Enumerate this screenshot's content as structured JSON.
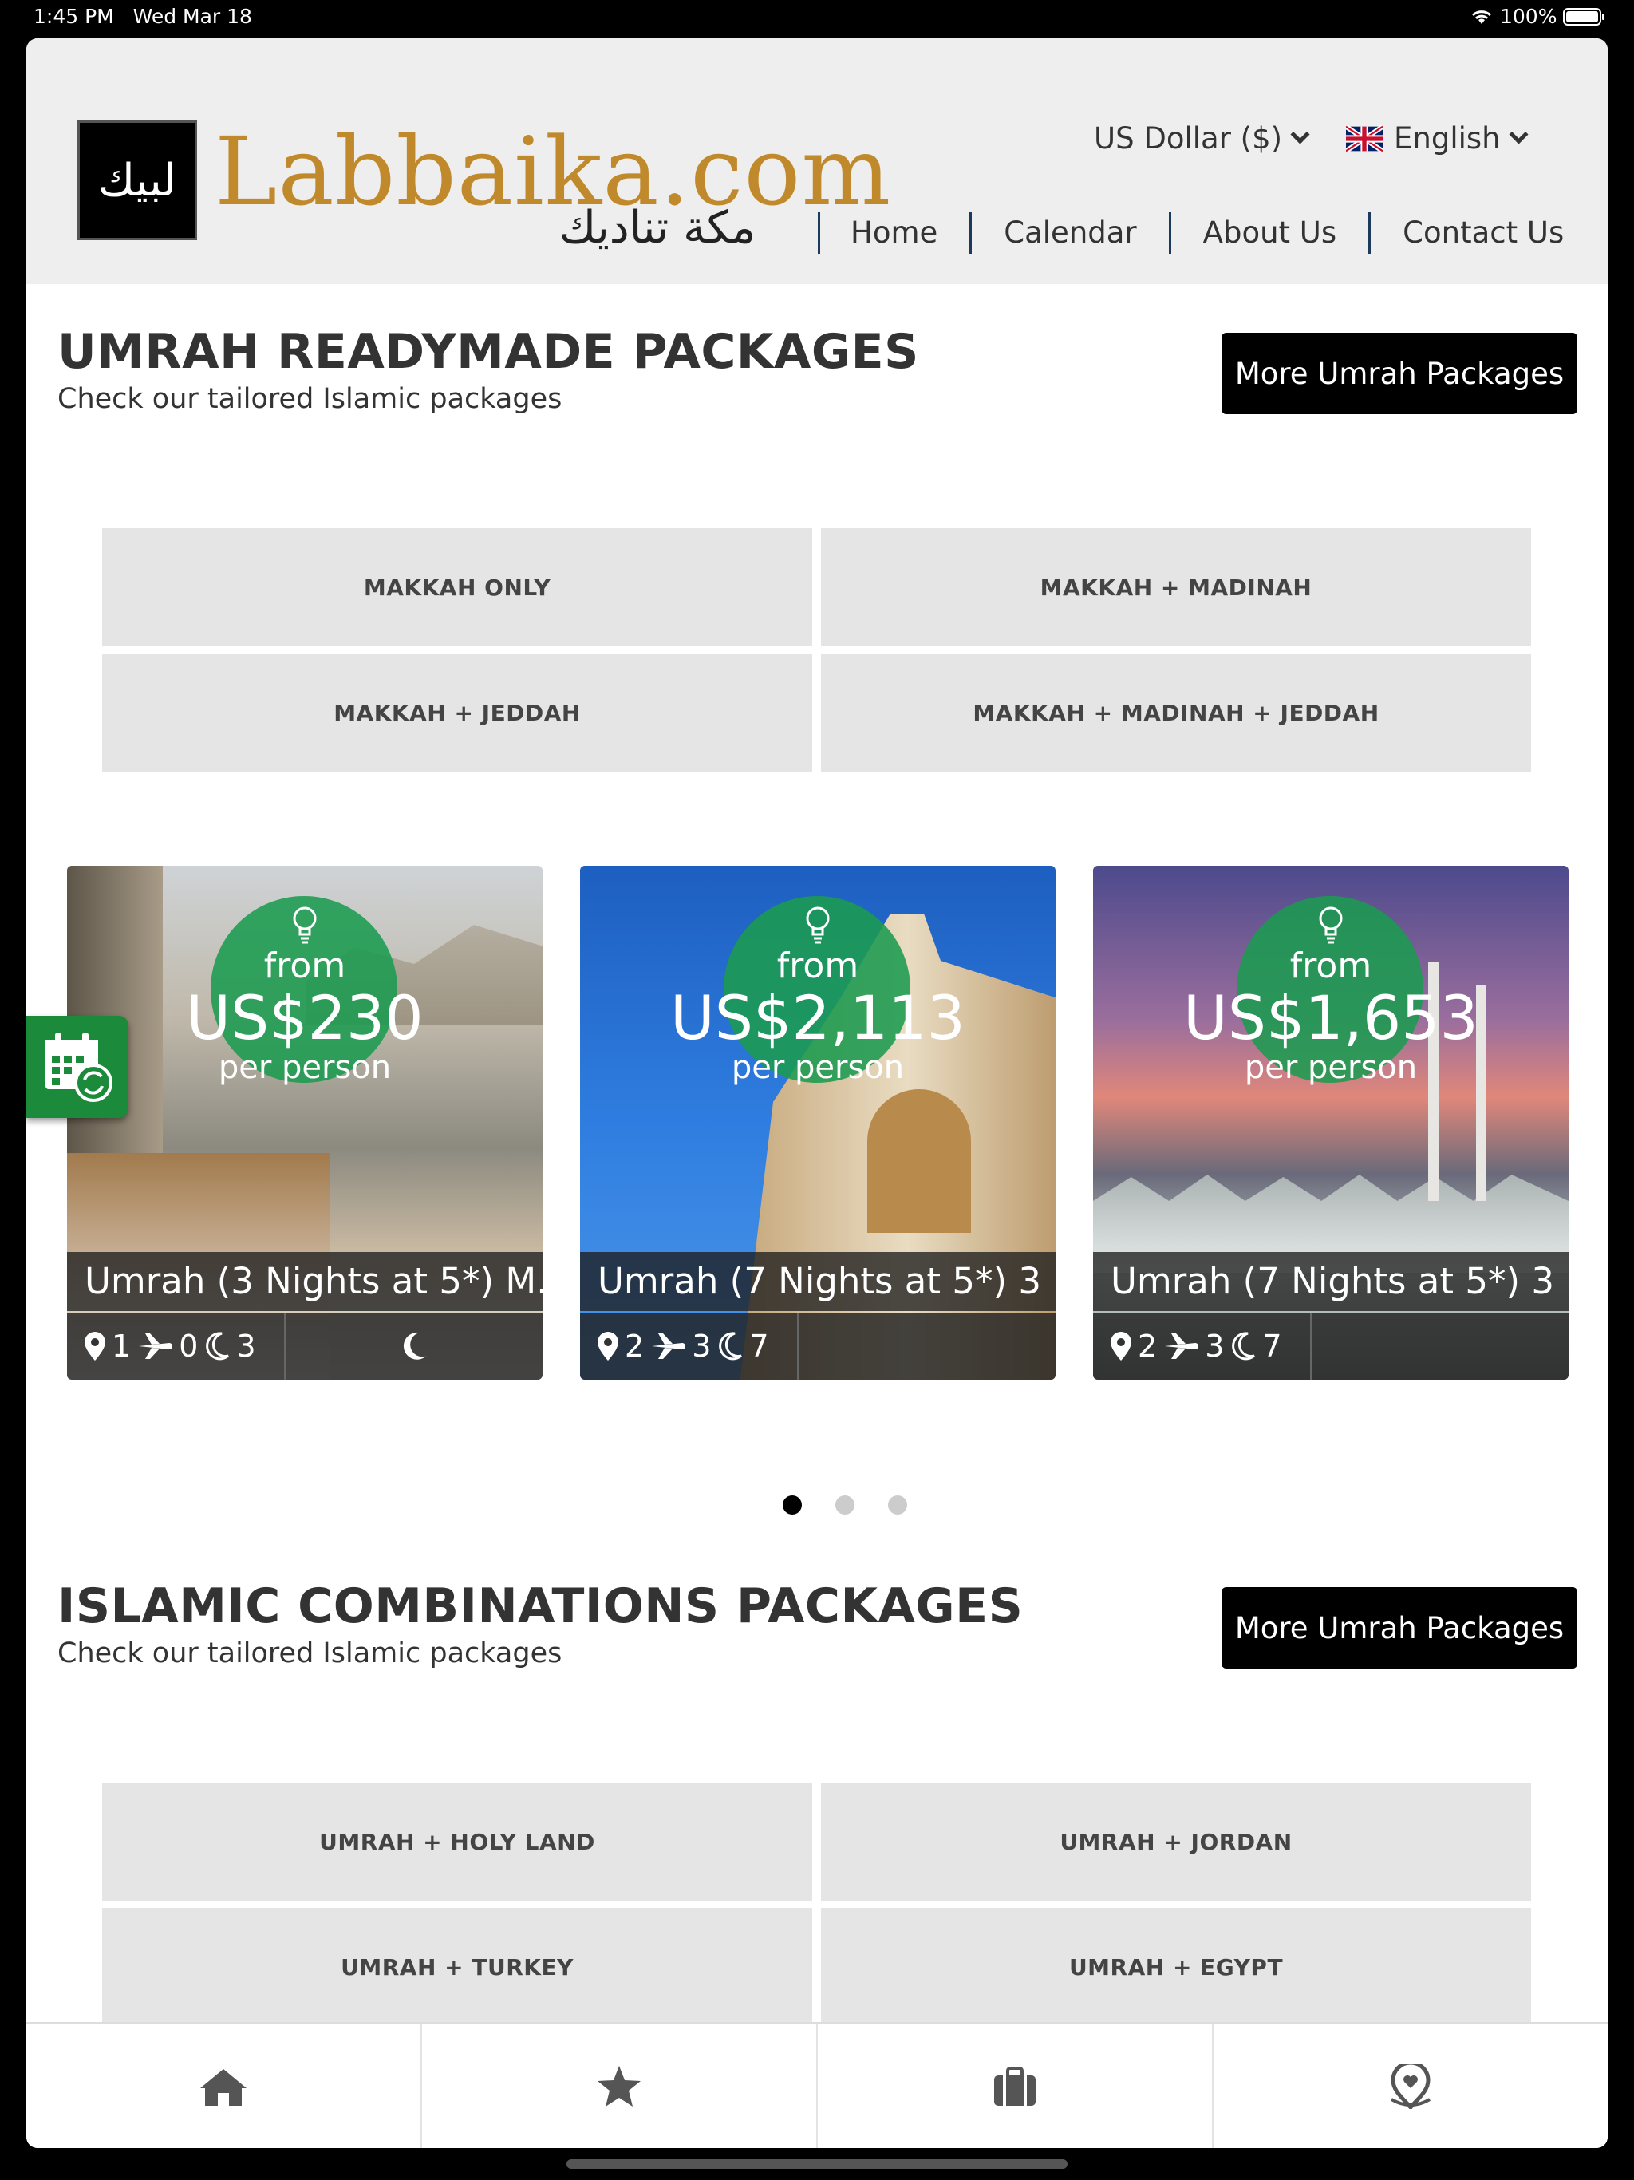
{
  "status_bar": {
    "time": "1:45 PM",
    "date": "Wed Mar 18",
    "battery": "100%"
  },
  "header": {
    "logo_arabic": "لبيك",
    "logo_text": "Labbaika.com",
    "logo_sub": "مكة تناديك",
    "currency": "US Dollar ($)",
    "language": "English",
    "nav": [
      "Home",
      "Calendar",
      "About Us",
      "Contact Us"
    ]
  },
  "section1": {
    "title": "UMRAH READYMADE PACKAGES",
    "subtitle": "Check our tailored Islamic packages",
    "more_label": "More Umrah Packages",
    "categories": [
      "MAKKAH ONLY",
      "MAKKAH + MADINAH",
      "MAKKAH + JEDDAH",
      "MAKKAH + MADINAH + JEDDAH"
    ]
  },
  "cards": [
    {
      "from": "from",
      "price": "US$230",
      "per": "per person",
      "title": "Umrah (3 Nights at 5*) M...",
      "locations": "1",
      "flights": "0",
      "nights": "3"
    },
    {
      "from": "from",
      "price": "US$2,113",
      "per": "per person",
      "title": "Umrah (7 Nights at 5*) 3 ...",
      "locations": "2",
      "flights": "3",
      "nights": "7"
    },
    {
      "from": "from",
      "price": "US$1,653",
      "per": "per person",
      "title": "Umrah (7 Nights at 5*) 3 ...",
      "locations": "2",
      "flights": "3",
      "nights": "7"
    }
  ],
  "section2": {
    "title": "ISLAMIC COMBINATIONS PACKAGES",
    "subtitle": "Check our tailored Islamic packages",
    "more_label": "More Umrah Packages",
    "categories": [
      "UMRAH + HOLY LAND",
      "UMRAH + JORDAN",
      "UMRAH + TURKEY",
      "UMRAH + EGYPT"
    ]
  },
  "tabbar": [
    "home-icon",
    "star-icon",
    "luggage-icon",
    "map-pin-heart-icon"
  ],
  "colors": {
    "accent_gold": "#c08a2c",
    "price_green": "#1b9b50",
    "calendar_green": "#1b8a3a"
  }
}
